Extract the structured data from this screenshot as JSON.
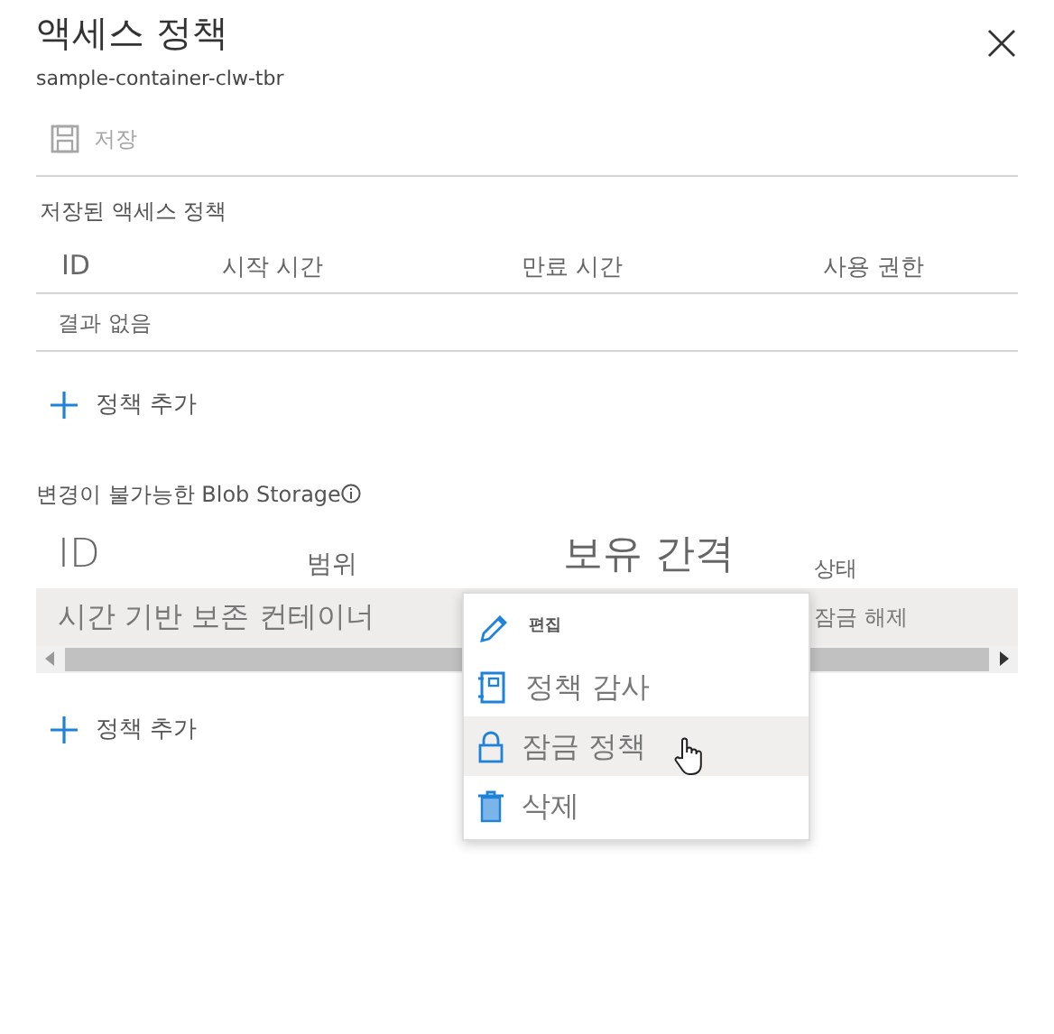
{
  "panel": {
    "title": "액세스 정책",
    "subtitle": "sample-container-clw-tbr"
  },
  "toolbar": {
    "save": {
      "label": "저장",
      "disabled": true
    }
  },
  "stored_policies": {
    "heading": "저장된 액세스 정책",
    "columns": [
      "ID",
      "시작 시간",
      "만료 시간",
      "사용 권한"
    ],
    "empty_text": "결과 없음",
    "add_label": "정책 추가"
  },
  "immutable": {
    "heading": "변경이 불가능한 Blob Storage",
    "columns": [
      "ID",
      "범위",
      "보유 간격",
      "상태"
    ],
    "rows": [
      {
        "cells": [
          "시간 기반 보존 컨테이너",
          "",
          "",
          "잠금 해제"
        ],
        "selected": true
      }
    ],
    "add_label": "정책 추가"
  },
  "context_menu": [
    {
      "kind": "edit",
      "label": "편집",
      "hovered": false
    },
    {
      "kind": "audit",
      "label": "정책 감사",
      "hovered": false
    },
    {
      "kind": "lock",
      "label": "잠금 정책",
      "hovered": true
    },
    {
      "kind": "delete",
      "label": "삭제",
      "hovered": false
    }
  ]
}
